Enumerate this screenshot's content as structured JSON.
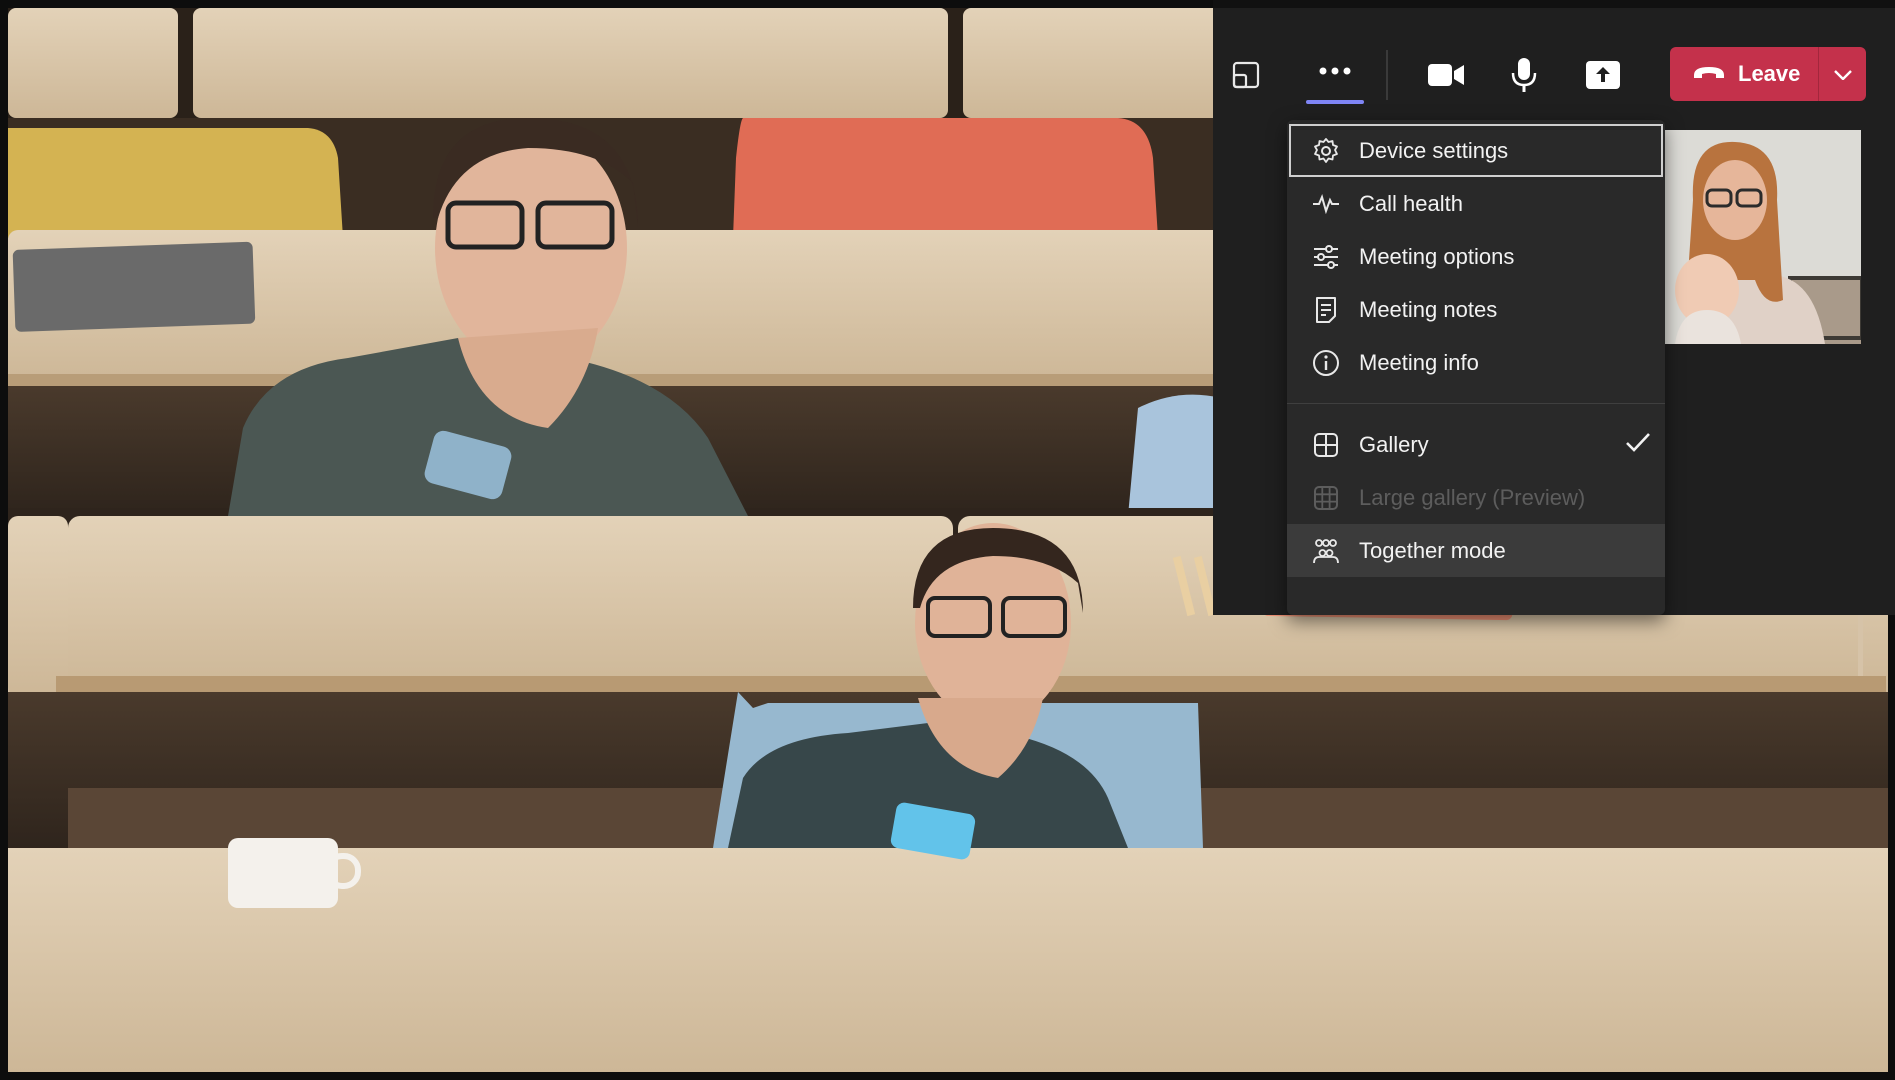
{
  "toolbar": {
    "share_tray_icon": "share-screen-icon",
    "more_icon": "more-actions-icon",
    "camera_icon": "camera-icon",
    "mic_icon": "microphone-icon",
    "share_icon": "share-content-icon",
    "leave_label": "Leave",
    "leave_icon": "hang-up-icon",
    "leave_dropdown_icon": "chevron-down-icon"
  },
  "menu": {
    "items": [
      {
        "label": "Device settings",
        "icon": "gear-icon",
        "state": "focused"
      },
      {
        "label": "Call health",
        "icon": "pulse-icon",
        "state": "normal"
      },
      {
        "label": "Meeting options",
        "icon": "sliders-icon",
        "state": "normal"
      },
      {
        "label": "Meeting notes",
        "icon": "notes-icon",
        "state": "normal"
      },
      {
        "label": "Meeting info",
        "icon": "info-icon",
        "state": "normal"
      }
    ],
    "views": [
      {
        "label": "Gallery",
        "icon": "grid-icon",
        "checked": true,
        "state": "normal"
      },
      {
        "label": "Large gallery (Preview)",
        "icon": "large-grid-icon",
        "checked": false,
        "state": "disabled"
      },
      {
        "label": "Together mode",
        "icon": "together-mode-icon",
        "checked": false,
        "state": "hover"
      }
    ]
  },
  "colors": {
    "leave": "#c4314b",
    "accent": "#7f85f5",
    "menu_bg": "#292929",
    "panel_bg": "#1f1f1f"
  }
}
